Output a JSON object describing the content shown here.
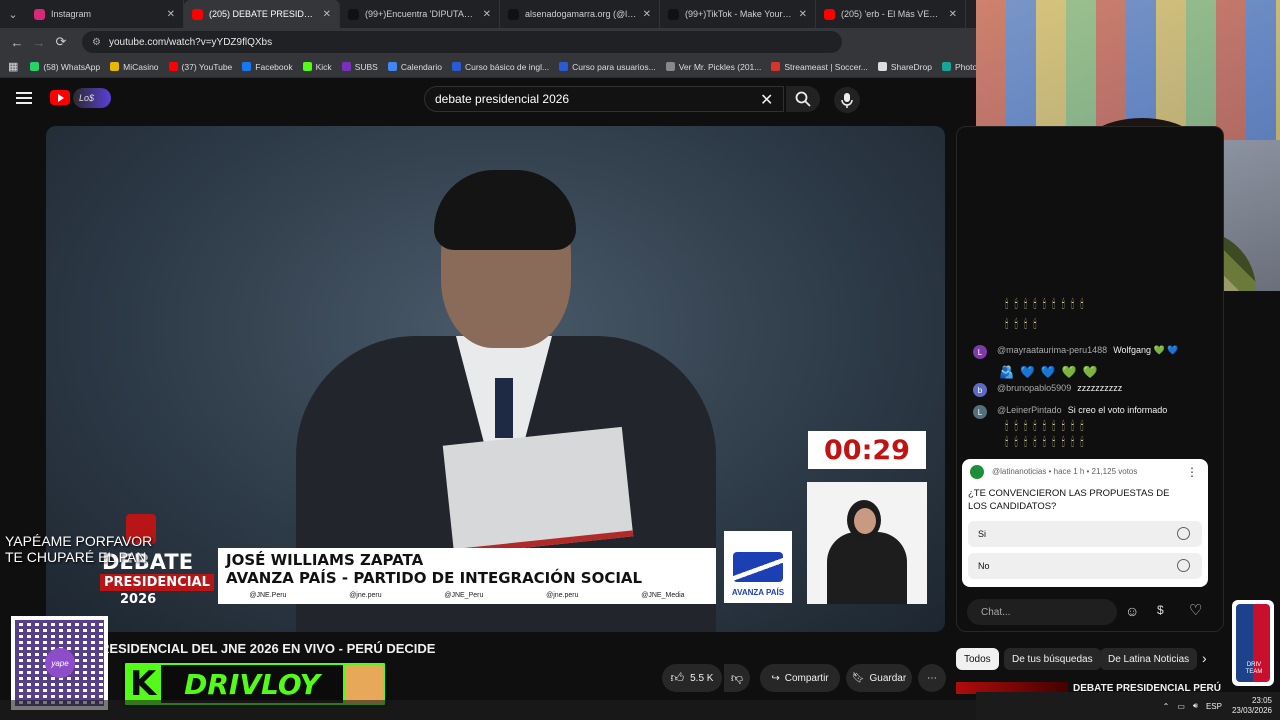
{
  "browser": {
    "tabs": [
      {
        "title": "Instagram",
        "color": "#d62976",
        "active": false
      },
      {
        "title": "(205) DEBATE PRESIDENCIAL",
        "color": "#ff0000",
        "active": true
      },
      {
        "title": "(99+)Encuentra 'DIPUTADO VE",
        "color": "#111111",
        "active": false
      },
      {
        "title": "alsenadogamarra.org (@licenci",
        "color": "#111111",
        "active": false
      },
      {
        "title": "(99+)TikTok - Make Your Day",
        "color": "#111111",
        "active": false
      },
      {
        "title": "(205) 'erb - El Más VERDE de la",
        "color": "#ff0000",
        "active": false
      }
    ],
    "url": "youtube.com/watch?v=yYDZ9flQXbs",
    "bookmarks": [
      {
        "label": "(58) WhatsApp",
        "color": "#25d366"
      },
      {
        "label": "MiCasino",
        "color": "#e6b800"
      },
      {
        "label": "(37) YouTube",
        "color": "#ff0000"
      },
      {
        "label": "Facebook",
        "color": "#1877f2"
      },
      {
        "label": "Kick",
        "color": "#53fc18"
      },
      {
        "label": "SUBS",
        "color": "#7b2fbf"
      },
      {
        "label": "Calendario",
        "color": "#4285f4"
      },
      {
        "label": "Curso básico de ingl...",
        "color": "#2a5bd7"
      },
      {
        "label": "Curso para usuarios...",
        "color": "#2a5bd7"
      },
      {
        "label": "Ver Mr. Pickles (201...",
        "color": "#888888"
      },
      {
        "label": "Streameast | Soccer...",
        "color": "#d9342b"
      },
      {
        "label": "ShareDrop",
        "color": "#dddddd"
      },
      {
        "label": "Photopea",
        "color": "#18a497"
      }
    ]
  },
  "youtube": {
    "logo_text": "Lo$",
    "search_query": "debate presidencial 2026",
    "video_title": "RESIDENCIAL DEL JNE 2026 EN VIVO - PERÚ DECIDE",
    "likes": "5.5 K",
    "share_label": "Compartir",
    "save_label": "Guardar",
    "chips": [
      "Todos",
      "De tus búsquedas",
      "De Latina Noticias"
    ],
    "related_title": "DEBATE PRESIDENCIAL PERÚ"
  },
  "video": {
    "timer": "00:29",
    "lower_third_line1": "JOSÉ WILLIAMS ZAPATA",
    "lower_third_line2": "AVANZA PAÍS - PARTIDO DE INTEGRACIÓN SOCIAL",
    "socials": [
      "@JNE.Peru",
      "@jne.peru",
      "@JNE_Peru",
      "@jne.peru",
      "@JNE_Media"
    ],
    "party_logo_text": "AVANZA PAÍS",
    "brand_line1": "DEBATE",
    "brand_line2": "PRESIDENCIAL",
    "brand_line3": "2026"
  },
  "chat": {
    "messages": [
      {
        "author": "@mayraataurima-peru1488",
        "text": "Wolfgang 💚 💙",
        "avatar": "L",
        "avatar_color": "#7e3aa8"
      },
      {
        "author": "@brunopablo5909",
        "text": "zzzzzzzzzz",
        "avatar": "b",
        "avatar_color": "#5c6bc0"
      },
      {
        "author": "@LeinerPintado",
        "text": "Si creo el voto informado",
        "avatar": "L",
        "avatar_color": "#546e7a"
      }
    ],
    "poll": {
      "meta": "@latinanoticias • hace 1 h • 21,125 votos",
      "question": "¿TE CONVENCIERON LAS PROPUESTAS DE LOS CANDIDATOS?",
      "options": [
        "Si",
        "No"
      ]
    },
    "input_placeholder": "Chat..."
  },
  "overlay": {
    "yape_text_1": "YAPÉAME PORFAVOR",
    "yape_text_2": "TE CHUPARÉ EL PAN",
    "qr_label": "yape",
    "kick_letter": "K",
    "kick_name": "DRIVLOY",
    "nba_text": "DRIV TEAM"
  },
  "taskbar": {
    "lang": "ESP",
    "time": "23:05",
    "date": "23/03/2026"
  }
}
